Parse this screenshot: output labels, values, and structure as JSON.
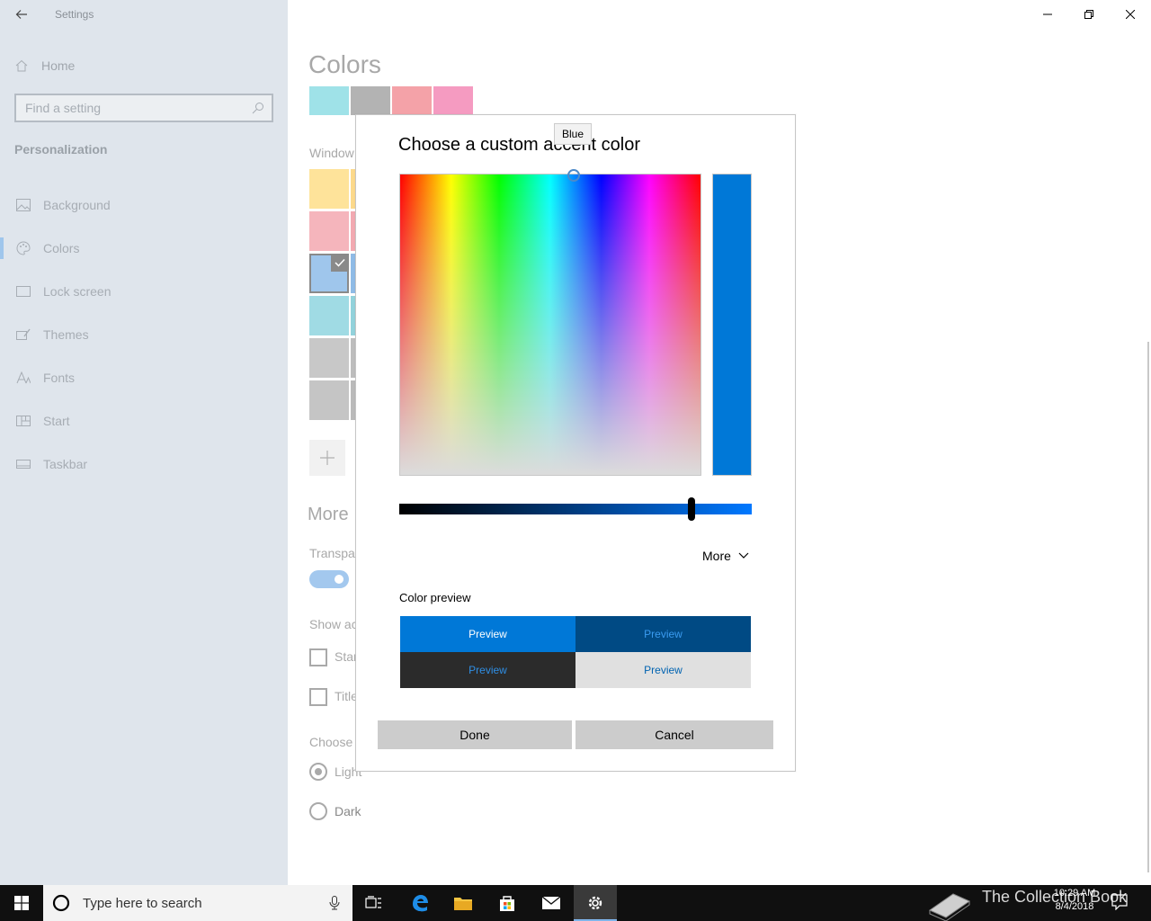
{
  "app": {
    "title": "Settings"
  },
  "nav": {
    "home_label": "Home",
    "search_placeholder": "Find a setting",
    "section_label": "Personalization",
    "items": [
      {
        "label": "Background",
        "icon": "picture-icon"
      },
      {
        "label": "Colors",
        "icon": "palette-icon",
        "active": true
      },
      {
        "label": "Lock screen",
        "icon": "lock-screen-icon"
      },
      {
        "label": "Themes",
        "icon": "brush-icon"
      },
      {
        "label": "Fonts",
        "icon": "font-icon"
      },
      {
        "label": "Start",
        "icon": "start-layout-icon"
      },
      {
        "label": "Taskbar",
        "icon": "taskbar-icon"
      }
    ]
  },
  "content": {
    "title": "Colors",
    "recent_colors": [
      "#9fe2e8",
      "#b3b3b3",
      "#f4a2a8",
      "#f59bc1"
    ],
    "windows_colors_label": "Window",
    "more_options_label": "More",
    "transparency_label": "Transpar",
    "show_accent_label": "Show ac",
    "start_checkbox_label": "Star",
    "title_bars_checkbox_label": "Title",
    "choose_mode_label": "Choose y",
    "mode_light_label": "Light",
    "mode_dark_label": "Dark",
    "grid_swatch_colors": [
      "#fee39a",
      "#f5b5bc",
      "#9fc6ec",
      "#a0dbe4",
      "#c8c8c8",
      "#c5c5c5"
    ]
  },
  "dialog": {
    "title": "Choose a custom accent color",
    "tooltip": "Blue",
    "selected_color": "#0078d7",
    "brightness_fraction": 0.83,
    "more_label": "More",
    "preview_label": "Color preview",
    "preview_cells": [
      {
        "label": "Preview",
        "bg": "#0078d7",
        "fg": "#ffffff"
      },
      {
        "label": "Preview",
        "bg": "#004a84",
        "fg": "#3a9bf0"
      },
      {
        "label": "Preview",
        "bg": "#2b2b2b",
        "fg": "#2f8ee4"
      },
      {
        "label": "Preview",
        "bg": "#e0e0e0",
        "fg": "#0063b1"
      }
    ],
    "done_label": "Done",
    "cancel_label": "Cancel"
  },
  "taskbar": {
    "search_placeholder": "Type here to search",
    "watermark": "The Collection Book",
    "time": "10:29 AM",
    "date": "8/4/2018"
  }
}
